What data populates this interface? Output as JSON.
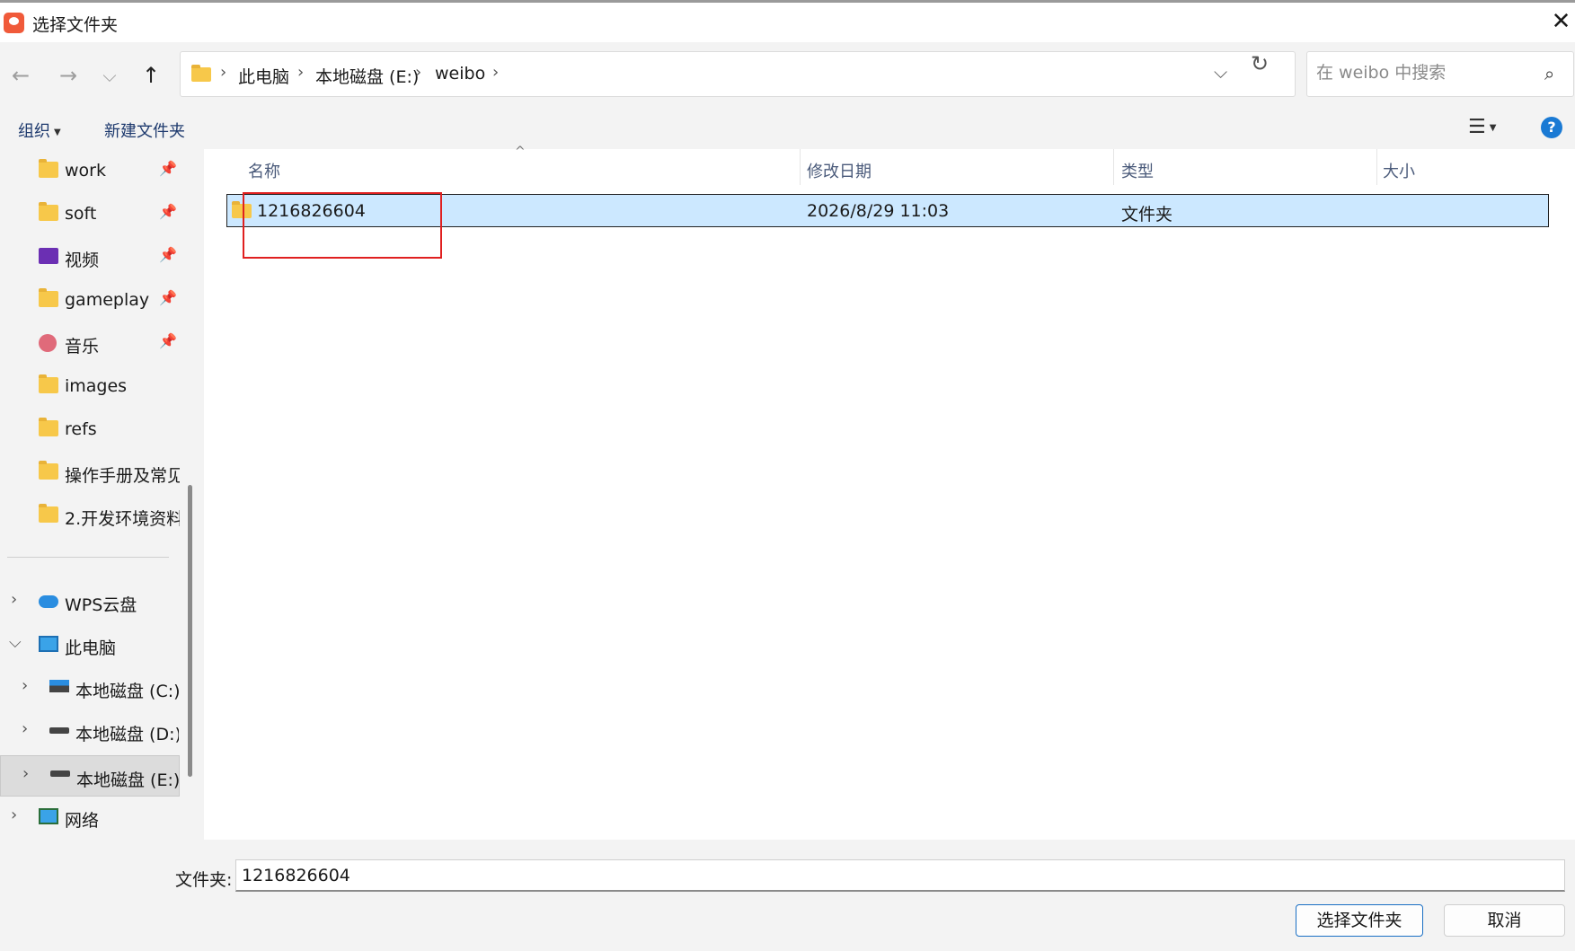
{
  "window": {
    "title": "选择文件夹",
    "close_glyph": "✕"
  },
  "nav": {
    "back_glyph": "←",
    "forward_glyph": "→",
    "recent_glyph": "⌵",
    "up_glyph": "↑"
  },
  "address": {
    "crumbs": [
      "此电脑",
      "本地磁盘 (E:)",
      "weibo"
    ],
    "separator": "›",
    "dropdown_glyph": "⌵",
    "refresh_glyph": "↻"
  },
  "search": {
    "placeholder": "在 weibo 中搜索",
    "icon_glyph": "⌕"
  },
  "toolbar": {
    "organize": "组织",
    "new_folder": "新建文件夹",
    "view_glyph": "☰",
    "help_glyph": "?"
  },
  "sidebar": {
    "quick": [
      {
        "label": "work",
        "icon": "folder-icon"
      },
      {
        "label": "soft",
        "icon": "folder-icon"
      },
      {
        "label": "视频",
        "icon": "video-icon"
      },
      {
        "label": "gameplay",
        "icon": "folder-icon"
      },
      {
        "label": "音乐",
        "icon": "music-icon"
      },
      {
        "label": "images",
        "icon": "folder-icon"
      },
      {
        "label": "refs",
        "icon": "folder-icon"
      },
      {
        "label": "操作手册及常见问题",
        "icon": "folder-icon"
      },
      {
        "label": "2.开发环境资料",
        "icon": "folder-icon"
      }
    ],
    "pin_glyph": "📌",
    "tree": [
      {
        "label": "WPS云盘",
        "icon": "cloud-icon",
        "expander": "›"
      },
      {
        "label": "此电脑",
        "icon": "pc-icon",
        "expander": "⌵"
      },
      {
        "label": "本地磁盘 (C:)",
        "icon": "drive-icon",
        "expander": "›"
      },
      {
        "label": "本地磁盘 (D:)",
        "icon": "drive-icon",
        "expander": "›"
      },
      {
        "label": "本地磁盘 (E:)",
        "icon": "drive-icon",
        "expander": "›"
      },
      {
        "label": "网络",
        "icon": "network-icon",
        "expander": "›"
      }
    ]
  },
  "table": {
    "columns": [
      "名称",
      "修改日期",
      "类型",
      "大小"
    ],
    "sort_glyph": "^",
    "rows": [
      {
        "name": "1216826604",
        "modified": "2026/8/29 11:03",
        "type": "文件夹",
        "size": ""
      }
    ]
  },
  "footer": {
    "folder_label": "文件夹:",
    "folder_value": "1216826604",
    "select_button": "选择文件夹",
    "cancel_button": "取消"
  },
  "colors": {
    "selection": "#cce8ff",
    "highlight_box": "#e02020",
    "accent": "#1a7ad4"
  }
}
